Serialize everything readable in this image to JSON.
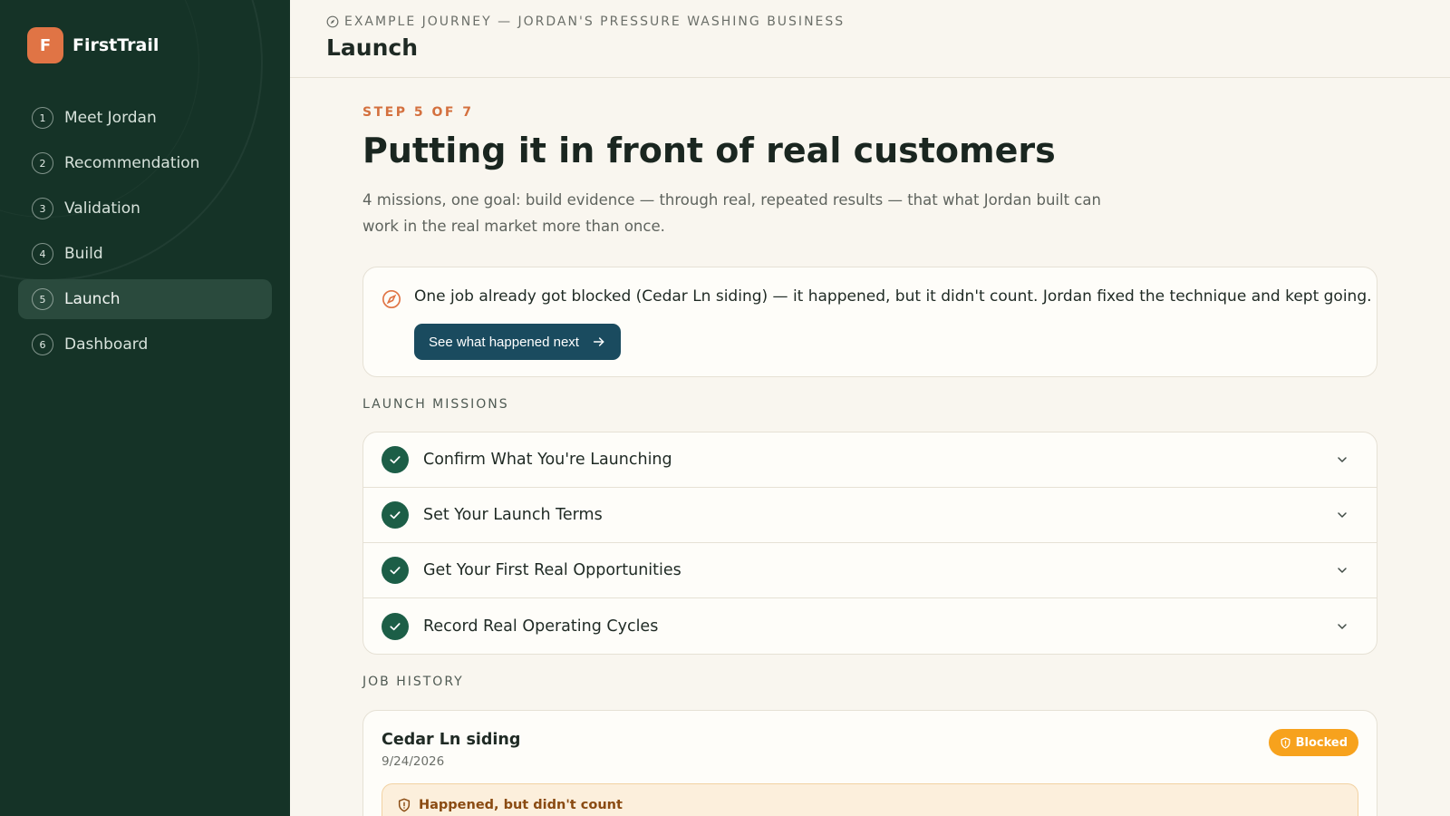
{
  "brand": {
    "logo_letter": "F",
    "name": "FirstTrail"
  },
  "sidebar": {
    "items": [
      {
        "num": "1",
        "label": "Meet Jordan",
        "active": false
      },
      {
        "num": "2",
        "label": "Recommendation",
        "active": false
      },
      {
        "num": "3",
        "label": "Validation",
        "active": false
      },
      {
        "num": "4",
        "label": "Build",
        "active": false
      },
      {
        "num": "5",
        "label": "Launch",
        "active": true
      },
      {
        "num": "6",
        "label": "Dashboard",
        "active": false
      }
    ]
  },
  "header": {
    "breadcrumb": "EXAMPLE JOURNEY — JORDAN'S PRESSURE WASHING BUSINESS",
    "breadcrumb_icon": "compass-icon",
    "title": "Launch"
  },
  "main": {
    "step": "STEP 5 OF 7",
    "headline": "Putting it in front of real customers",
    "intro": "4 missions, one goal: build evidence — through real, repeated results — that what Jordan built can work in the real market more than once.",
    "notice": {
      "icon": "compass-icon",
      "text": "One job already got blocked (Cedar Ln siding) — it happened, but it didn't count. Jordan fixed the technique and kept going.",
      "button_label": "See what happened next",
      "button_icon": "arrow-right-icon"
    },
    "missions_label": "LAUNCH MISSIONS",
    "missions": [
      {
        "label": "Confirm What You're Launching",
        "done": true
      },
      {
        "label": "Set Your Launch Terms",
        "done": true
      },
      {
        "label": "Get Your First Real Opportunities",
        "done": true
      },
      {
        "label": "Record Real Operating Cycles",
        "done": true
      }
    ],
    "history_label": "JOB HISTORY",
    "jobs": [
      {
        "title": "Cedar Ln siding",
        "date": "9/24/2026",
        "status": "Blocked",
        "status_icon": "shield-icon",
        "note": "Happened, but didn't count",
        "note_icon": "shield-icon"
      }
    ]
  },
  "colors": {
    "sidebar_bg": "#153327",
    "accent_orange": "#e07445",
    "primary_button": "#1a4b5f",
    "check_green": "#1c5e47",
    "badge_amber": "#f7a21d",
    "page_bg": "#f9f6ef"
  }
}
